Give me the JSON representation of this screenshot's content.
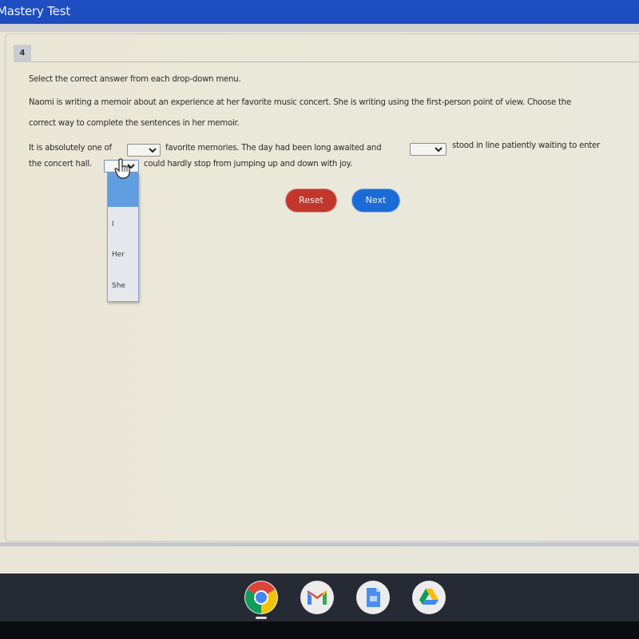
{
  "app": {
    "title": "Mastery Test"
  },
  "question": {
    "number": "4",
    "instruction": "Select the correct answer from each drop-down menu.",
    "prompt_line1": "Naomi is writing a memoir about an experience at her favorite music concert. She is writing using the first-person point of view. Choose the",
    "prompt_line2": "correct way to complete the sentences in her memoir.",
    "sentence": {
      "part1": "It is absolutely one of",
      "part2": "favorite memories. The day had been long awaited and",
      "part3": "stood in line patiently waiting to enter",
      "part4": "the concert hall.",
      "part5": "could hardly stop from jumping up and down with joy."
    },
    "dropdowns": [
      {
        "selected": "",
        "open": false
      },
      {
        "selected": "",
        "open": false
      },
      {
        "selected": "",
        "open": true,
        "options": [
          "",
          "I",
          "Her",
          "She"
        ],
        "highlighted_index": 0
      }
    ]
  },
  "buttons": {
    "reset": "Reset",
    "next": "Next"
  },
  "colors": {
    "header": "#1f4fc2",
    "reset": "#c1372c",
    "next": "#1a6bd6",
    "highlight": "#5f9ee0"
  },
  "shelf": {
    "apps": [
      {
        "name": "Chrome",
        "icon": "chrome-icon",
        "running": true
      },
      {
        "name": "Gmail",
        "icon": "gmail-icon",
        "running": false
      },
      {
        "name": "Docs",
        "icon": "docs-icon",
        "running": false
      },
      {
        "name": "Drive",
        "icon": "drive-icon",
        "running": false
      }
    ]
  }
}
